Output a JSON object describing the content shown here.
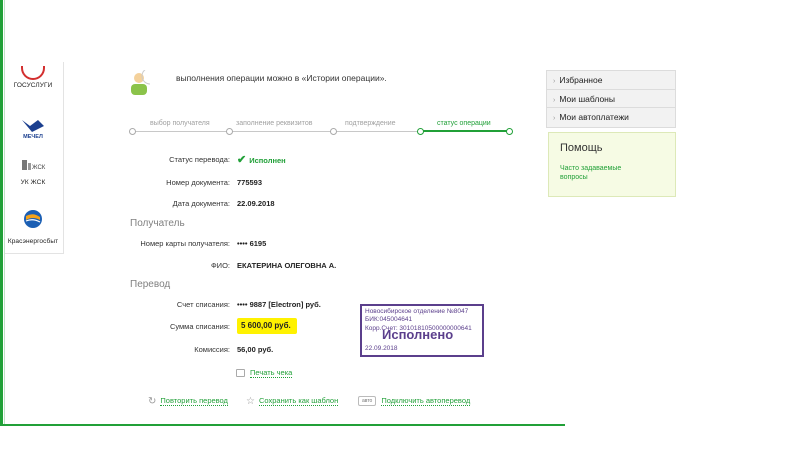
{
  "intro_text": "выполнения операции можно в «Истории операции».",
  "steps": [
    {
      "label": "выбор получателя",
      "active": false
    },
    {
      "label": "заполнение реквизитов",
      "active": false
    },
    {
      "label": "подтверждение",
      "active": false
    },
    {
      "label": "статус операции",
      "active": true
    }
  ],
  "services": {
    "gosuslugi": "ГОСУСЛУГИ",
    "mechel": "МЕЧЕЛ",
    "zhk_logo": "ЖСК",
    "zhk": "УК ЖСК",
    "krasenergo": "Красэнергосбыт"
  },
  "transfer": {
    "status_label": "Статус перевода:",
    "status_value": "Исполнен",
    "doc_number_label": "Номер документа:",
    "doc_number": "775593",
    "doc_date_label": "Дата документа:",
    "doc_date": "22.09.2018"
  },
  "recipient": {
    "section_title": "Получатель",
    "card_label": "Номер карты получателя:",
    "card_value": "•••• 6195",
    "fio_label": "ФИО:",
    "fio_value": "ЕКАТЕРИНА ОЛЕГОВНА А."
  },
  "payment": {
    "section_title": "Перевод",
    "account_label": "Счет списания:",
    "account_value": "•••• 9887  [Electron]  руб.",
    "amount_label": "Сумма списания:",
    "amount_value": "5 600,00  руб.",
    "fee_label": "Комиссия:",
    "fee_value": "56,00 руб."
  },
  "stamp": {
    "line1": "Новосибирское отделение №8047",
    "line2": "БИК:045004641",
    "line3": "Корр.Счет: 30101810500000000641",
    "big": "Исполнено",
    "date": "22.09.2018"
  },
  "print_label": "Печать чека",
  "actions": {
    "repeat": "Повторить перевод",
    "save_template": "Сохранить как шаблон",
    "auto_badge": "авто",
    "autopay": "Подключить автоперевод"
  },
  "right_menu": [
    "Избранное",
    "Мои шаблоны",
    "Мои автоплатежи"
  ],
  "help": {
    "title": "Помощь",
    "link": "Часто задаваемые вопросы"
  },
  "colors": {
    "brand_green": "#21a038",
    "highlight_yellow": "#fff200",
    "stamp_purple": "#5b3f8c"
  }
}
